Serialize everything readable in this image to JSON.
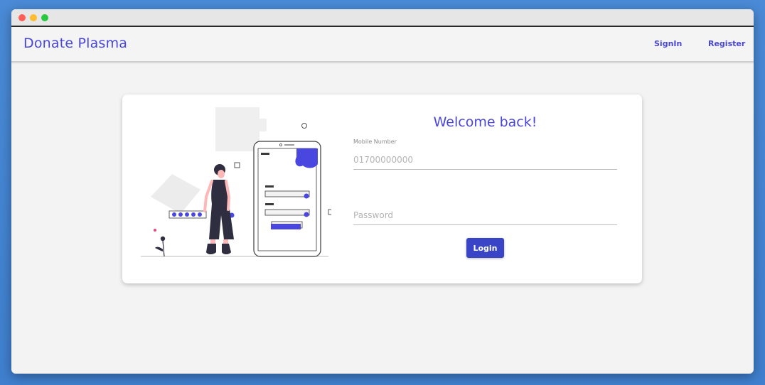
{
  "window": {
    "controls": [
      "close",
      "minimize",
      "maximize"
    ]
  },
  "navbar": {
    "brand": "Donate Plasma",
    "links": [
      {
        "label": "SignIn"
      },
      {
        "label": "Register"
      }
    ]
  },
  "login": {
    "heading": "Welcome back!",
    "mobile_label": "Mobile Number",
    "mobile_placeholder": "01700000000",
    "mobile_value": "",
    "password_placeholder": "Password",
    "password_value": "",
    "login_label": "Login"
  },
  "colors": {
    "accent": "#4a47d8",
    "button": "#3a44c6",
    "illustration_dark": "#2f2e41",
    "illustration_accent": "#4a47e0"
  }
}
